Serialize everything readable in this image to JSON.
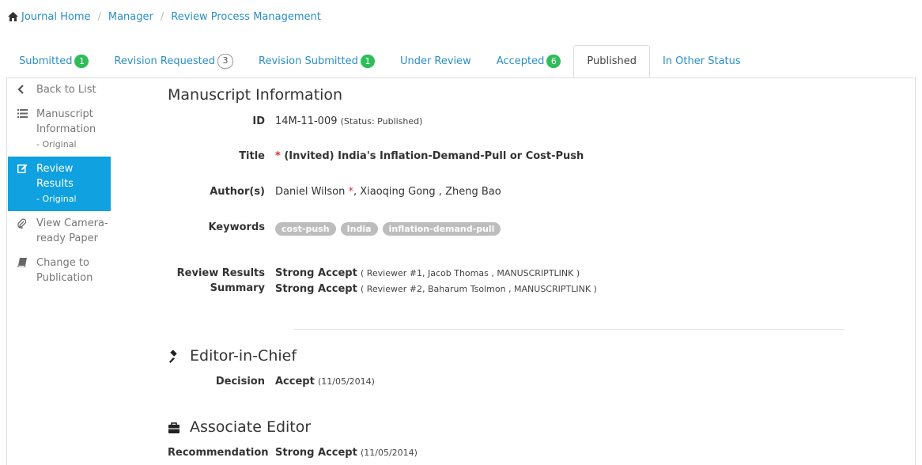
{
  "breadcrumb": {
    "items": [
      "Journal Home",
      "Manager",
      "Review Process Management"
    ],
    "separator": "/"
  },
  "tabs": [
    {
      "label": "Submitted",
      "badge": "1",
      "badge_style": "green"
    },
    {
      "label": "Revision Requested",
      "badge": "3",
      "badge_style": "outline"
    },
    {
      "label": "Revision Submitted",
      "badge": "1",
      "badge_style": "green"
    },
    {
      "label": "Under Review",
      "badge": null
    },
    {
      "label": "Accepted",
      "badge": "6",
      "badge_style": "green"
    },
    {
      "label": "Published",
      "badge": null,
      "active": true
    },
    {
      "label": "In Other Status",
      "badge": null
    }
  ],
  "sidenav": {
    "back": "Back to List",
    "manuscript": {
      "label": "Manuscript Information",
      "sub": "- Original"
    },
    "review": {
      "label": "Review Results",
      "sub": "- Original"
    },
    "camera": {
      "label": "View Camera-ready Paper"
    },
    "change": {
      "label": "Change to Publication"
    }
  },
  "manuscript": {
    "heading": "Manuscript Information",
    "id_label": "ID",
    "id": "14M-11-009",
    "status": "(Status: Published)",
    "title_label": "Title",
    "title_marker": "*",
    "title": "(Invited) India's Inflation-Demand-Pull or Cost-Push",
    "authors_label": "Author(s)",
    "author1": "Daniel Wilson",
    "author_marker": "*",
    "authors_rest": ", Xiaoqing Gong , Zheng Bao",
    "keywords_label": "Keywords",
    "keywords": [
      "cost-push",
      "India",
      "inflation-demand-pull"
    ],
    "review_label_1": "Review Results",
    "review_label_2": "Summary",
    "reviews": [
      {
        "decision": "Strong Accept",
        "detail": "( Reviewer #1, Jacob Thomas , MANUSCRIPTLINK )"
      },
      {
        "decision": "Strong Accept",
        "detail": "( Reviewer #2, Baharum Tsolmon , MANUSCRIPTLINK )"
      }
    ]
  },
  "editor_in_chief": {
    "heading": "Editor-in-Chief",
    "label": "Decision",
    "decision": "Accept",
    "date": "(11/05/2014)"
  },
  "associate_editor": {
    "heading": "Associate Editor",
    "label": "Recommendation",
    "decision": "Strong Accept",
    "date": "(11/05/2014)"
  },
  "colors": {
    "link": "#2a8fc7",
    "active_nav": "#0fa1e0",
    "badge_green": "#2ebd59",
    "required": "#e0302a"
  },
  "icons": [
    "home-icon",
    "chevron-left-icon",
    "list-icon",
    "edit-icon",
    "paperclip-icon",
    "book-icon",
    "gavel-icon",
    "briefcase-icon"
  ]
}
